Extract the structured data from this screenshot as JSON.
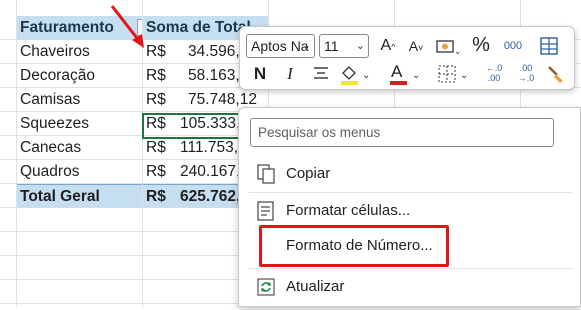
{
  "table": {
    "header": {
      "col_a": "Faturamento",
      "col_b": "Soma de Total"
    },
    "rows": [
      {
        "label": "Chaveiros",
        "currency": "R$",
        "value": "34.596,"
      },
      {
        "label": "Decoração",
        "currency": "R$",
        "value": "58.163,"
      },
      {
        "label": "Camisas",
        "currency": "R$",
        "value": "75.748,12"
      },
      {
        "label": "Squeezes",
        "currency": "R$",
        "value": "105.333,"
      },
      {
        "label": "Canecas",
        "currency": "R$",
        "value": "111.753,"
      },
      {
        "label": "Quadros",
        "currency": "R$",
        "value": "240.167,"
      }
    ],
    "total": {
      "label": "Total Geral",
      "currency": "R$",
      "value": "625.762,"
    }
  },
  "mini_toolbar": {
    "font_name": "Aptos Na",
    "font_size": "11",
    "percent": "%",
    "thousands": "000",
    "bold": "N",
    "italic": "I",
    "font_color_letter": "A",
    "grow_font": "A",
    "shrink_font": "A",
    "colors": {
      "highlight": "#f4e52a",
      "font": "#d41f1f"
    },
    "icons": [
      "increase-font-icon",
      "decrease-font-icon",
      "accounting-format-icon",
      "percent-icon",
      "comma-style-icon",
      "table-format-icon",
      "bold-icon",
      "italic-icon",
      "align-center-icon",
      "fill-color-icon",
      "font-color-icon",
      "borders-icon",
      "increase-decimal-icon",
      "decrease-decimal-icon",
      "format-painter-icon"
    ]
  },
  "context_menu": {
    "search_placeholder": "Pesquisar os menus",
    "items": [
      {
        "label": "Copiar",
        "icon": "copy-icon"
      },
      {
        "label": "Formatar células...",
        "icon": "format-cells-icon"
      },
      {
        "label": "Formato de Número...",
        "icon": ""
      },
      {
        "label": "Atualizar",
        "icon": "refresh-icon"
      }
    ]
  },
  "highlight_color": "#e3141a"
}
